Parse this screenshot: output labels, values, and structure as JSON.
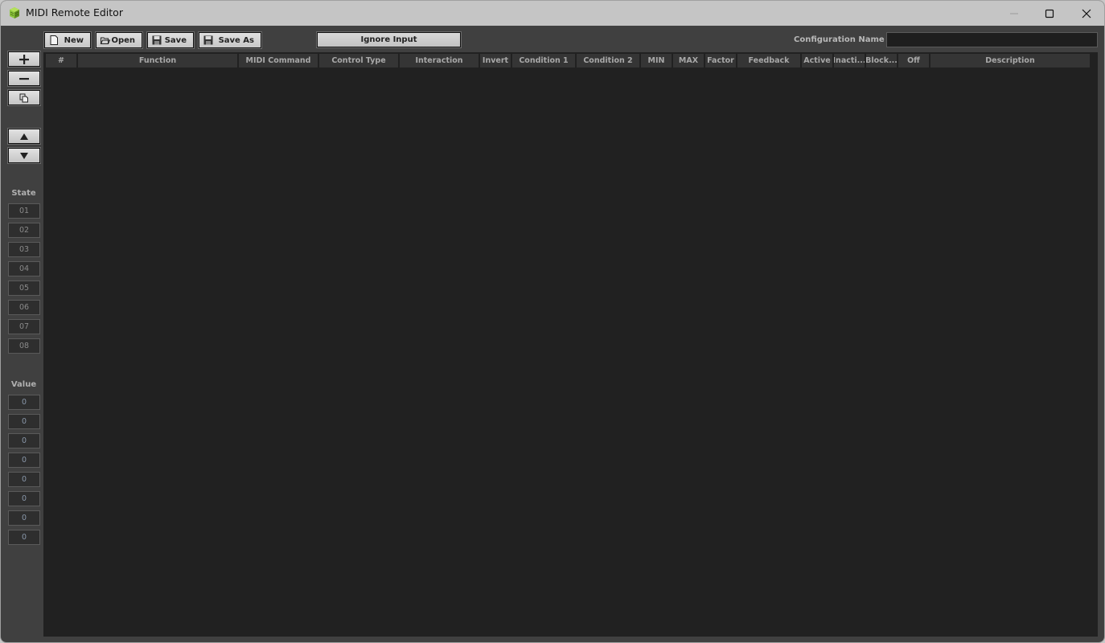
{
  "window": {
    "title": "MIDI Remote Editor",
    "icon": "green-cube-icon",
    "controls": {
      "minimize": "minimize-icon",
      "maximize": "maximize-icon",
      "close": "close-icon"
    }
  },
  "toolbar": {
    "new_label": "New",
    "open_label": "Open",
    "save_label": "Save",
    "save_as_label": "Save As",
    "ignore_input_label": "Ignore Input",
    "config_name_label": "Configuration Name :",
    "config_name_value": ""
  },
  "side_buttons": {
    "add": "plus-icon",
    "remove": "minus-icon",
    "duplicate": "copy-icon",
    "move_up": "arrow-up-icon",
    "move_down": "arrow-down-icon"
  },
  "state": {
    "heading": "State",
    "items": [
      "01",
      "02",
      "03",
      "04",
      "05",
      "06",
      "07",
      "08"
    ]
  },
  "value": {
    "heading": "Value",
    "items": [
      "0",
      "0",
      "0",
      "0",
      "0",
      "0",
      "0",
      "0"
    ]
  },
  "table": {
    "columns": [
      "#",
      "Function",
      "MIDI Command",
      "Control Type",
      "Interaction",
      "Invert",
      "Condition 1",
      "Condition 2",
      "MIN",
      "MAX",
      "Factor",
      "Feedback",
      "Active",
      "Inacti...",
      "Block...",
      "Off",
      "Description"
    ],
    "rows": []
  },
  "colors": {
    "titlebar": "#c5c5c5",
    "panel": "#404040",
    "table_bg": "#212121",
    "header_cell": "#353535",
    "icon_green": "#8dc63f"
  }
}
